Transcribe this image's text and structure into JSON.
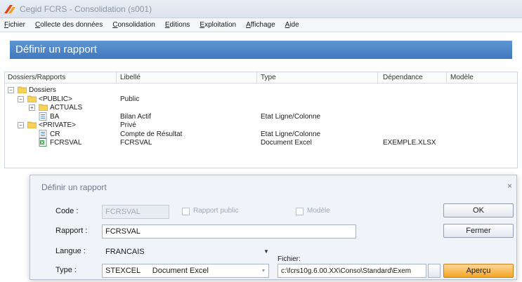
{
  "window": {
    "title": "Cegid FCRS - Consolidation (s001)"
  },
  "menu": [
    "Fichier",
    "Collecte des données",
    "Consolidation",
    "Editions",
    "Exploitation",
    "Affichage",
    "Aide"
  ],
  "panel": {
    "title": "Définir un rapport"
  },
  "tree": {
    "columns": [
      "Dossiers/Rapports",
      "Libellé",
      "Type",
      "Dépendance",
      "Modèle"
    ],
    "rows": [
      {
        "name": "Dossiers",
        "libelle": "",
        "type": "",
        "dependance": "",
        "modele": ""
      },
      {
        "name": "<PUBLIC>",
        "libelle": "Public",
        "type": "",
        "dependance": "",
        "modele": ""
      },
      {
        "name": "ACTUALS",
        "libelle": "",
        "type": "",
        "dependance": "",
        "modele": ""
      },
      {
        "name": "BA",
        "libelle": "Bilan Actif",
        "type": "Etat Ligne/Colonne",
        "dependance": "",
        "modele": ""
      },
      {
        "name": "<PRIVATE>",
        "libelle": "Privé",
        "type": "",
        "dependance": "",
        "modele": ""
      },
      {
        "name": "CR",
        "libelle": "Compte de Résultat",
        "type": "Etat Ligne/Colonne",
        "dependance": "",
        "modele": ""
      },
      {
        "name": "FCRSVAL",
        "libelle": "FCRSVAL",
        "type": "Document Excel",
        "dependance": "EXEMPLE.XLSX",
        "modele": ""
      }
    ]
  },
  "dialog": {
    "title": "Définir un rapport",
    "close": "×",
    "code_label": "Code :",
    "code_value": "FCRSVAL",
    "rapport_public_label": "Rapport public",
    "modele_label": "Modèle",
    "rapport_label": "Rapport :",
    "rapport_value": "FCRSVAL",
    "langue_label": "Langue :",
    "langue_value": "FRANCAIS",
    "type_label": "Type :",
    "type_code": "STEXCEL",
    "type_value": "Document Excel",
    "fichier_label": "Fichier:",
    "fichier_value": "c:\\fcrs10g.6.00.XX\\Conso\\Standard\\Exem",
    "ok_label": "OK",
    "fermer_label": "Fermer",
    "apercu_label": "Aperçu"
  },
  "colors": {
    "header": "#4a83c7",
    "accent": "#f5a623"
  }
}
